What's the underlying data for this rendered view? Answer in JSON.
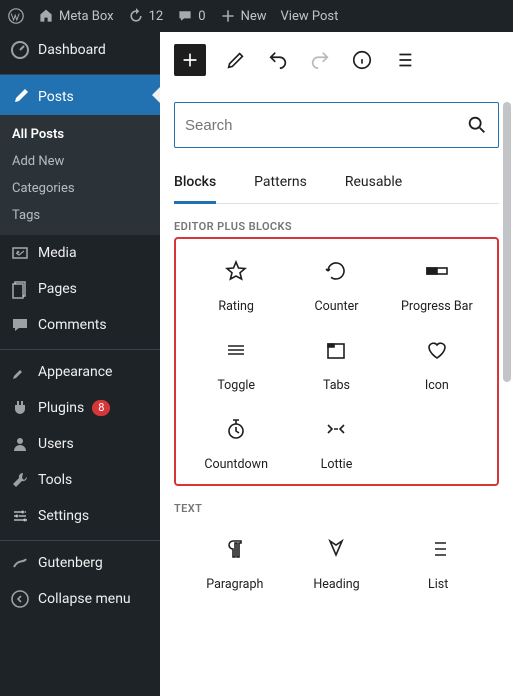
{
  "adminbar": {
    "site": "Meta Box",
    "updates": "12",
    "comments": "0",
    "new": "New",
    "view": "View Post"
  },
  "sidebar": {
    "dashboard": "Dashboard",
    "posts": "Posts",
    "submenu": [
      "All Posts",
      "Add New",
      "Categories",
      "Tags"
    ],
    "media": "Media",
    "pages": "Pages",
    "comments": "Comments",
    "appearance": "Appearance",
    "plugins": "Plugins",
    "plugins_badge": "8",
    "users": "Users",
    "tools": "Tools",
    "settings": "Settings",
    "gutenberg": "Gutenberg",
    "collapse": "Collapse menu"
  },
  "search": {
    "placeholder": "Search"
  },
  "tabs": [
    "Blocks",
    "Patterns",
    "Reusable"
  ],
  "sections": {
    "editor_plus": "EDITOR PLUS BLOCKS",
    "text": "TEXT"
  },
  "blocks": [
    {
      "icon": "star",
      "label": "Rating"
    },
    {
      "icon": "counter",
      "label": "Counter"
    },
    {
      "icon": "progress",
      "label": "Progress Bar"
    },
    {
      "icon": "toggle",
      "label": "Toggle"
    },
    {
      "icon": "tabs",
      "label": "Tabs"
    },
    {
      "icon": "heart",
      "label": "Icon"
    },
    {
      "icon": "countdown",
      "label": "Countdown"
    },
    {
      "icon": "lottie",
      "label": "Lottie"
    }
  ],
  "text_blocks": [
    {
      "icon": "paragraph",
      "label": "Paragraph"
    },
    {
      "icon": "heading",
      "label": "Heading"
    },
    {
      "icon": "list",
      "label": "List"
    }
  ]
}
